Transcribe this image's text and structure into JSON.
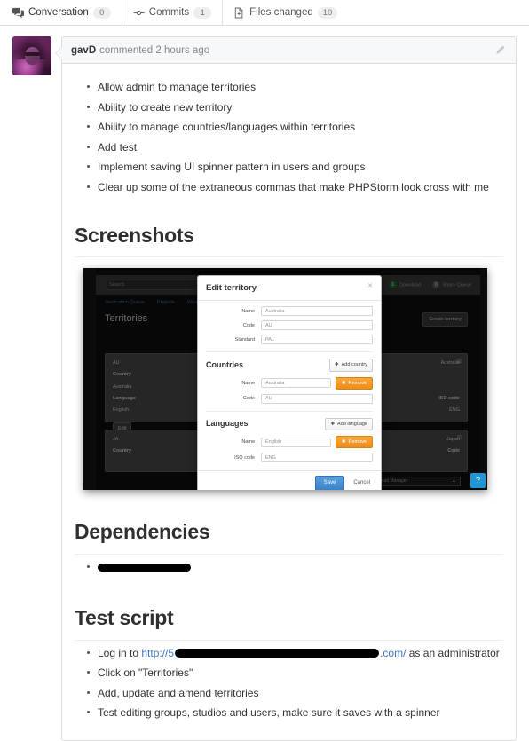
{
  "tabs": [
    {
      "label": "Conversation",
      "count": "0",
      "icon": "comment-discussion-icon",
      "active": true
    },
    {
      "label": "Commits",
      "count": "1",
      "icon": "git-commit-icon",
      "active": false
    },
    {
      "label": "Files changed",
      "count": "10",
      "icon": "file-diff-icon",
      "active": false
    }
  ],
  "comment": {
    "author": "gavD",
    "meta": "commented 2 hours ago",
    "edit_icon": "pencil-icon",
    "avatar_name": "user-avatar",
    "bullets": [
      "Allow admin to manage territories",
      "Ability to create new territory",
      "Ability to manage countries/languages within territories",
      "Add test",
      "Implement saving UI spinner pattern in users and groups",
      "Clear up some of the extraneous commas that make PHPStorm look cross with me"
    ]
  },
  "sections": {
    "screenshots": {
      "heading": "Screenshots"
    },
    "dependencies": {
      "heading": "Dependencies",
      "items": [
        {
          "redacted": true,
          "text": ""
        }
      ]
    },
    "test_script": {
      "heading": "Test script",
      "items": [
        {
          "prefix": "Log in to ",
          "link_text": "http://5",
          "redacted": true,
          "link_suffix": ".com/",
          "suffix": " as an administrator"
        },
        {
          "text": "Click on \"Territories\""
        },
        {
          "text": "Add, update and amend territories"
        },
        {
          "text": "Test editing groups, studios and users, make sure it saves with a spinner"
        }
      ]
    }
  },
  "screenshot": {
    "app": {
      "search_placeholder": "Search",
      "search_icon": "search-icon",
      "status": [
        {
          "label": "Download",
          "count": "1",
          "color": "#1d6b2e"
        },
        {
          "label": "Share Queue",
          "count": "0",
          "color": "#5a5a5a"
        }
      ],
      "nav": [
        "Verification Queue",
        "Projects",
        "Work Requests"
      ],
      "page_title": "Territories",
      "create_button": "Create territory",
      "cards": [
        {
          "code": "AU",
          "name": "Australia",
          "col_country": "Country",
          "country_value": "Australia",
          "col_language": "Language",
          "col_iso": "ISO code",
          "language_value": "English",
          "iso_value": "ENG",
          "edit_label": "Edit"
        },
        {
          "code": "JA",
          "name": "Japan",
          "col_country": "Country",
          "col_code": "Code"
        }
      ],
      "download_manager": "Plexd Download Manager",
      "help_icon": "help-icon"
    },
    "modal": {
      "title": "Edit territory",
      "close_icon": "close-icon",
      "fields": [
        {
          "label": "Name",
          "value": "Australia"
        },
        {
          "label": "Code",
          "value": "AU"
        },
        {
          "label": "Standard",
          "value": "PAL"
        }
      ],
      "countries": {
        "title": "Countries",
        "add_label": "Add country",
        "remove_label": "Remove",
        "fields": [
          {
            "label": "Name",
            "value": "Australia"
          },
          {
            "label": "Code",
            "value": "AU"
          }
        ]
      },
      "languages": {
        "title": "Languages",
        "add_label": "Add language",
        "remove_label": "Remove",
        "fields": [
          {
            "label": "Name",
            "value": "English"
          },
          {
            "label": "ISO code",
            "value": "ENG"
          }
        ]
      },
      "save_label": "Save",
      "cancel_label": "Cancel"
    }
  }
}
